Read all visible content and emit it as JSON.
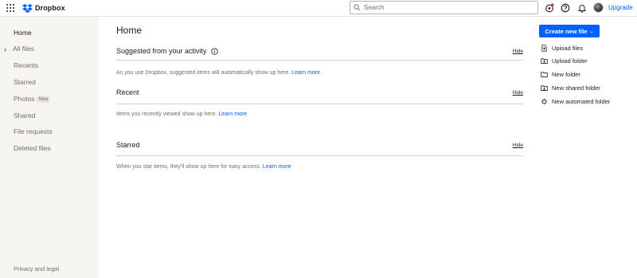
{
  "brand": {
    "name": "Dropbox",
    "accent": "#0061fe"
  },
  "search": {
    "placeholder": "Search"
  },
  "header": {
    "upgrade_label": "Upgrade"
  },
  "sidebar": {
    "items": [
      {
        "label": "Home"
      },
      {
        "label": "All files"
      },
      {
        "label": "Recents"
      },
      {
        "label": "Starred"
      },
      {
        "label": "Photos",
        "badge": "New"
      },
      {
        "label": "Shared"
      },
      {
        "label": "File requests"
      },
      {
        "label": "Deleted files"
      }
    ],
    "footer_label": "Privacy and legal"
  },
  "main": {
    "title": "Home",
    "sections": [
      {
        "title": "Suggested from your activity",
        "hide_label": "Hide",
        "text": "As you use Dropbox, suggested items will automatically show up here.",
        "link": "Learn more"
      },
      {
        "title": "Recent",
        "hide_label": "Hide",
        "text": "Items you recently viewed show up here.",
        "link": "Learn more"
      },
      {
        "title": "Starred",
        "hide_label": "Hide",
        "text": "When you star items, they'll show up here for easy access.",
        "link": "Learn more"
      }
    ]
  },
  "actions": {
    "create_label": "Create new file",
    "items": [
      {
        "label": "Upload files",
        "icon": "upload-file-icon"
      },
      {
        "label": "Upload folder",
        "icon": "upload-folder-icon"
      },
      {
        "label": "New folder",
        "icon": "folder-icon"
      },
      {
        "label": "New shared folder",
        "icon": "shared-folder-icon"
      },
      {
        "label": "New automated folder",
        "icon": "automated-folder-icon"
      }
    ]
  }
}
